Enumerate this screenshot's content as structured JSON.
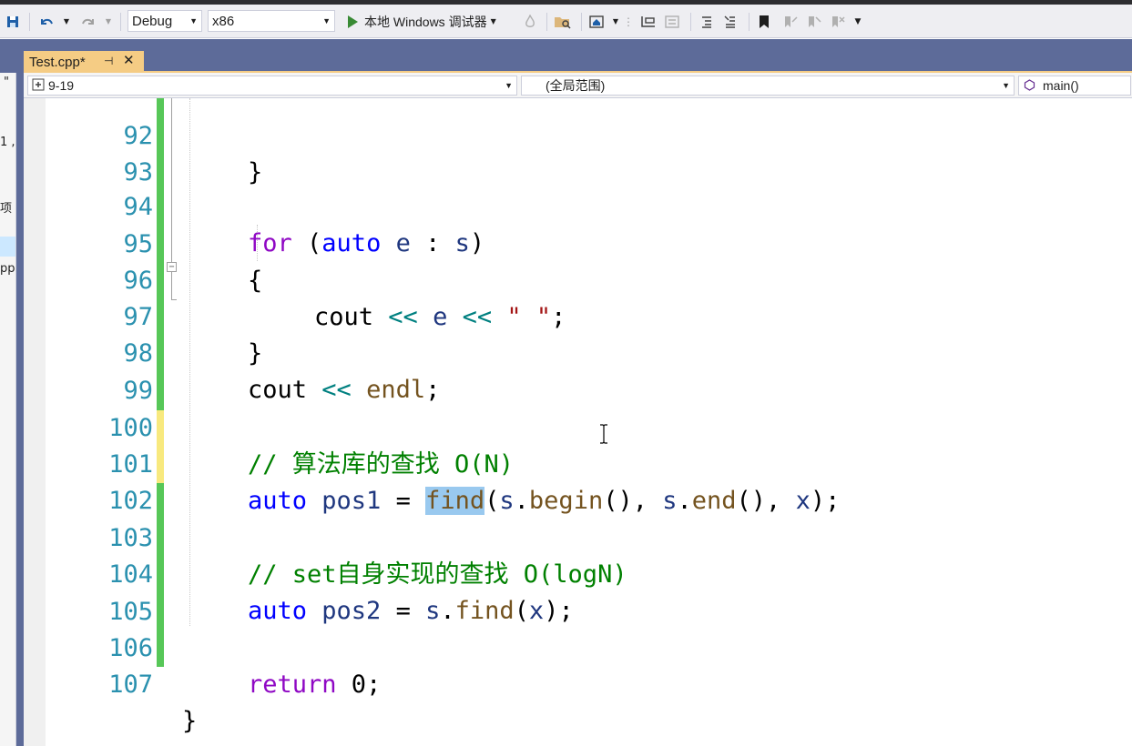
{
  "toolbar": {
    "config": "Debug",
    "platform": "x86",
    "run_label": "本地 Windows 调试器"
  },
  "tabs": [
    {
      "title": "Test.cpp*"
    }
  ],
  "navbar": {
    "project": "9-19",
    "scope": "(全局范围)",
    "member": "main()"
  },
  "left_panel": {
    "fragments": [
      "I",
      "\"",
      "1 ,",
      "项",
      "pp"
    ]
  },
  "editor": {
    "lines": [
      {
        "num": "92"
      },
      {
        "num": "93"
      },
      {
        "num": "94"
      },
      {
        "num": "95"
      },
      {
        "num": "96"
      },
      {
        "num": "97"
      },
      {
        "num": "98"
      },
      {
        "num": "99"
      },
      {
        "num": "100"
      },
      {
        "num": "101"
      },
      {
        "num": "102"
      },
      {
        "num": "103"
      },
      {
        "num": "104"
      },
      {
        "num": "105"
      },
      {
        "num": "106"
      },
      {
        "num": "107"
      }
    ],
    "tokens": {
      "l92_brace": "}",
      "l94_for": "for",
      "l94_paren_open": " (",
      "l94_auto": "auto",
      "l94_e": " e",
      "l94_colon": " : ",
      "l94_s": "s",
      "l94_paren_close": ")",
      "l95_brace": "{",
      "l96_cout": "cout",
      "l96_op1": " << ",
      "l96_e": "e",
      "l96_op2": " << ",
      "l96_str": "\" \"",
      "l96_semi": ";",
      "l97_brace": "}",
      "l98_cout": "cout",
      "l98_op": " << ",
      "l98_endl": "endl",
      "l98_semi": ";",
      "l100_comment": "// 算法库的查找 O(N)",
      "l101_auto": "auto",
      "l101_pos1": " pos1",
      "l101_eq": " = ",
      "l101_find": "find",
      "l101_p1": "(",
      "l101_s1": "s",
      "l101_dot1": ".",
      "l101_begin": "begin",
      "l101_p2": "(), ",
      "l101_s2": "s",
      "l101_dot2": ".",
      "l101_end": "end",
      "l101_p3": "(), ",
      "l101_x": "x",
      "l101_p4": ");",
      "l103_comment": "// set自身实现的查找 O(logN)",
      "l104_auto": "auto",
      "l104_pos2": " pos2",
      "l104_eq": " = ",
      "l104_s": "s",
      "l104_dot": ".",
      "l104_find": "find",
      "l104_p1": "(",
      "l104_x": "x",
      "l104_p2": ");",
      "l106_return": "return",
      "l106_zero": " 0",
      "l106_semi": ";",
      "l107_brace": "}"
    }
  },
  "colors": {
    "keyword": "#0000ff",
    "control_keyword": "#8f08c4",
    "function": "#74531f",
    "variable": "#1f377f",
    "operator": "#008080",
    "string": "#a31515",
    "comment": "#008000",
    "line_number": "#2b91af",
    "tab_active": "#f5cc84",
    "tab_row": "#5d6b99",
    "change_saved": "#57c758",
    "change_unsaved": "#f8e97e",
    "selection": "#99c9ef"
  },
  "icons": [
    "save-all-icon",
    "undo-icon",
    "redo-icon",
    "play-icon",
    "fire-icon",
    "folder-search-icon",
    "home-icon",
    "step-icon",
    "comment-icon",
    "uncomment-icon",
    "bookmark-icon",
    "prev-bookmark-icon",
    "next-bookmark-icon",
    "clear-bookmark-icon",
    "pin-icon",
    "close-icon",
    "class-icon",
    "method-icon"
  ]
}
